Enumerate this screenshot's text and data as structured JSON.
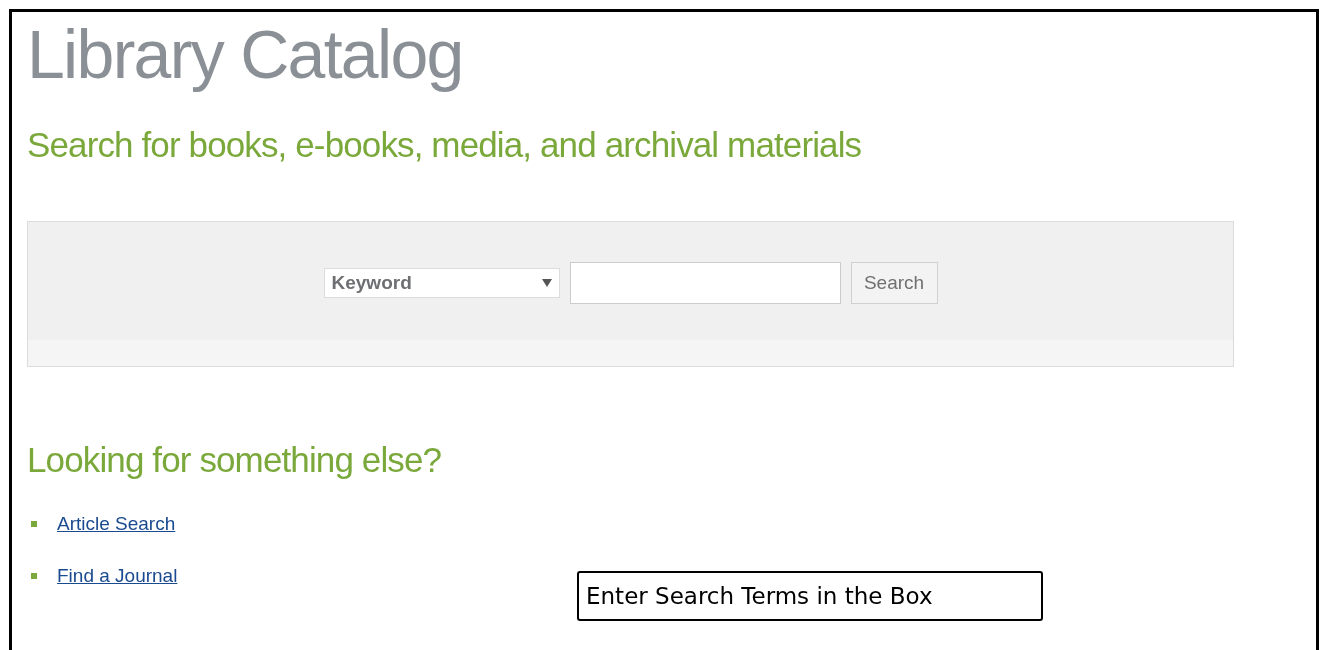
{
  "page": {
    "title": "Library Catalog",
    "subtitle": "Search for books, e-books, media, and archival materials"
  },
  "search": {
    "field_type": "Keyword",
    "button": "Search"
  },
  "more": {
    "heading": "Looking for something else?",
    "links": [
      "Article Search",
      "Find a Journal"
    ]
  },
  "callout": {
    "text": "Enter Search Terms in the Box"
  }
}
